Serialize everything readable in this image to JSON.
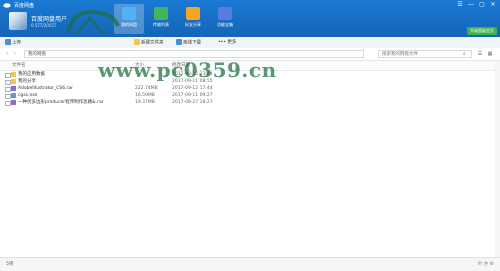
{
  "window": {
    "title": "百度网盘",
    "controls": [
      "☰",
      "—",
      "▢",
      "✕"
    ]
  },
  "user": {
    "name": "百度网盘用户",
    "quota": "0.57T/2055T"
  },
  "nav": [
    {
      "label": "我的网盘",
      "color": "#4fb3f6"
    },
    {
      "label": "传输列表",
      "color": "#46b45c"
    },
    {
      "label": "好友分享",
      "color": "#f6a623"
    },
    {
      "label": "功能宝箱",
      "color": "#5a7be0"
    }
  ],
  "upgrade_label": "升级超级会员",
  "toolbar": {
    "upload": "上传",
    "new_folder": "新建文件夹",
    "offline": "离线下载",
    "more": "更多"
  },
  "pathbar": {
    "back": "‹",
    "forward": "›",
    "path": "我的网盘",
    "search_placeholder": "搜索我的网盘文件"
  },
  "columns": {
    "name": "文件名",
    "size": "大小",
    "time": "修改日期"
  },
  "files": [
    {
      "name": "我的应用数据",
      "size": "-",
      "time": "2017-08-15 23:44",
      "color": "#f3c64a"
    },
    {
      "name": "我的分享",
      "size": "-",
      "time": "2017-09-11 08:55",
      "color": "#f3c64a"
    },
    {
      "name": "AdobeIllustrator_CS6.rar",
      "size": "222.74MB",
      "time": "2017-09-12 17:44",
      "color": "#8b6bd6"
    },
    {
      "name": "cgss.exe",
      "size": "16.59MB",
      "time": "2017-09-11 09:27",
      "color": "#5b9bd5"
    },
    {
      "name": "一种优多边形producer程序制作思路&.rar",
      "size": "19.37MB",
      "time": "2017-08-27 18:27",
      "color": "#8b6bd6"
    }
  ],
  "status": {
    "count": "5项"
  },
  "watermark": {
    "text": "www.pc0359.cn"
  }
}
